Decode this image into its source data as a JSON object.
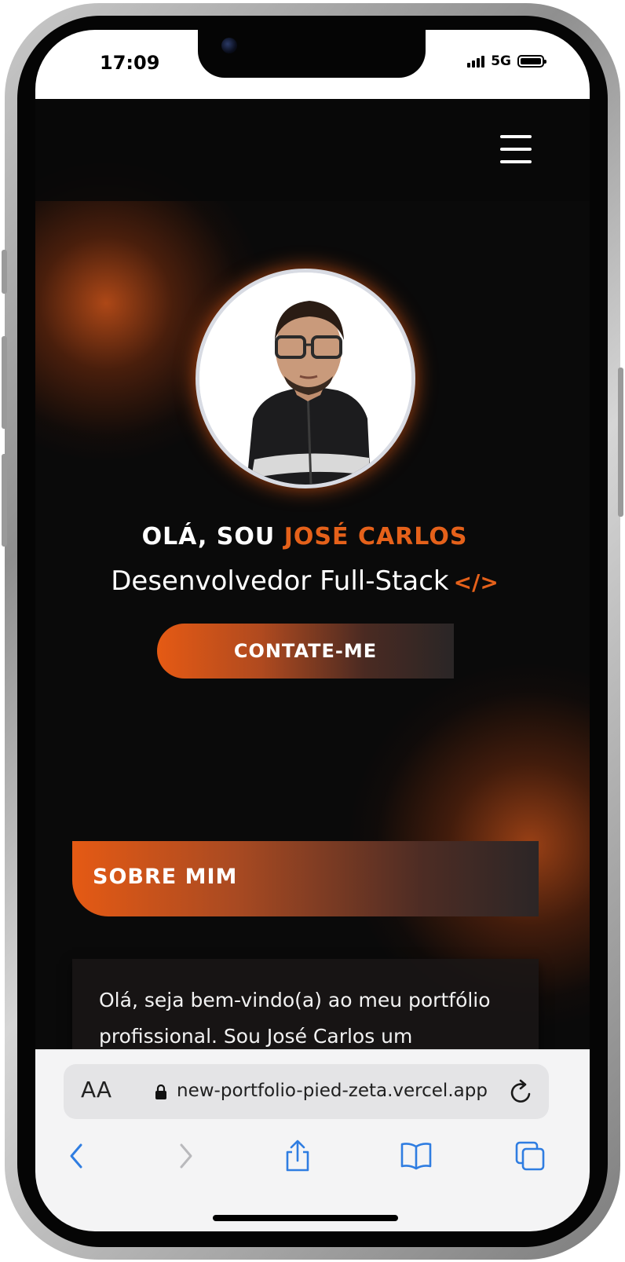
{
  "status_bar": {
    "time": "17:09",
    "network": "5G"
  },
  "header": {
    "menu_icon": "hamburger-menu-icon"
  },
  "hero": {
    "greeting_prefix": "OLÁ, SOU",
    "name": "JOSÉ CARLOS",
    "role": "Desenvolvedor Full-Stack",
    "code_icon": "</>",
    "contact_button": "CONTATE-ME"
  },
  "about": {
    "title": "SOBRE MIM",
    "text": "Olá, seja bem-vindo(a) ao meu portfólio profissional. Sou José Carlos um"
  },
  "browser": {
    "text_size_label": "AA",
    "url": "new-portfolio-pied-zeta.vercel.app"
  },
  "theme": {
    "accent": "#e5611a",
    "background": "#0a0a0a",
    "browser_link": "#2f7de1"
  }
}
